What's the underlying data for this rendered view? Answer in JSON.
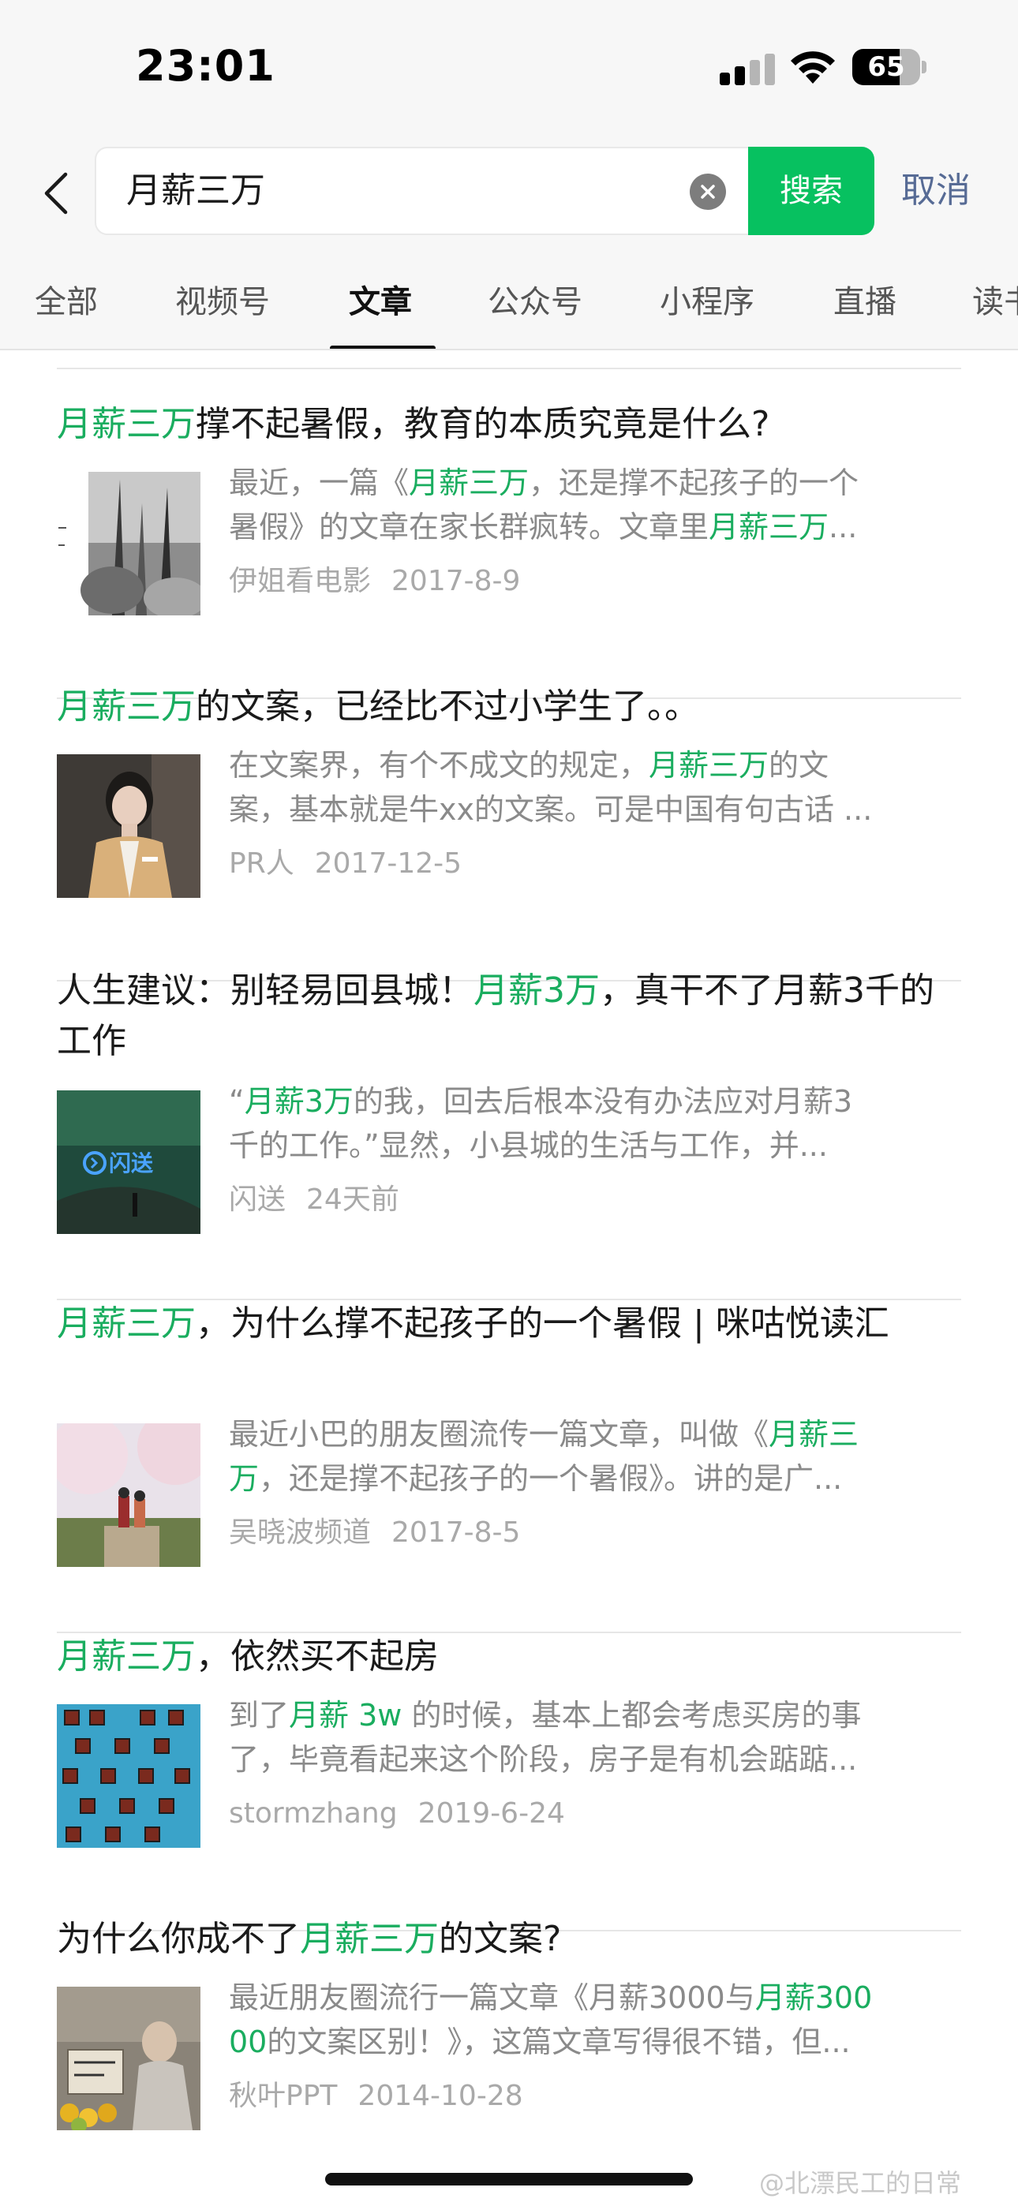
{
  "status_bar": {
    "time": "23:01",
    "battery": "65"
  },
  "search": {
    "query": "月薪三万",
    "search_button": "搜索",
    "cancel_button": "取消"
  },
  "tabs": [
    "全部",
    "视频号",
    "文章",
    "公众号",
    "小程序",
    "直播",
    "读书"
  ],
  "active_tab": "文章",
  "colors": {
    "accent_green": "#07c160",
    "highlight_green": "#1aad5f",
    "cancel_blue": "#576b95"
  },
  "results": [
    {
      "title": [
        {
          "t": "月薪三万",
          "hl": true
        },
        {
          "t": "撑不起暑假，教育的本质究竟是什么?",
          "hl": false
        }
      ],
      "snippet": [
        [
          {
            "t": "最近，一篇《",
            "hl": false
          },
          {
            "t": "月薪三万",
            "hl": true
          },
          {
            "t": "，还是撑不起孩子的一个",
            "hl": false
          }
        ],
        [
          {
            "t": "暑假》的文章在家长群疯转。文章里",
            "hl": false
          },
          {
            "t": "月薪三万",
            "hl": true
          },
          {
            "t": "...",
            "hl": false
          }
        ]
      ],
      "source": "伊姐看电影",
      "date": "2017-8-9",
      "thumb_icon": "photo-forest-icon"
    },
    {
      "title": [
        {
          "t": "月薪三万",
          "hl": true
        },
        {
          "t": "的文案，已经比不过小学生了。。",
          "hl": false
        }
      ],
      "snippet": [
        [
          {
            "t": "在文案界，有个不成文的规定，",
            "hl": false
          },
          {
            "t": "月薪三万",
            "hl": true
          },
          {
            "t": "的文",
            "hl": false
          }
        ],
        [
          {
            "t": "案，基本就是牛xx的文案。可是中国有句古话 ...",
            "hl": false
          }
        ]
      ],
      "source": "PR人",
      "date": "2017-12-5",
      "thumb_icon": "photo-woman-icon"
    },
    {
      "title": [
        {
          "t": "人生建议：别轻易回县城！",
          "hl": false
        },
        {
          "t": "月薪3万",
          "hl": true
        },
        {
          "t": "，真干不了月薪3千的工作",
          "hl": false
        }
      ],
      "snippet": [
        [
          {
            "t": "“",
            "hl": false
          },
          {
            "t": "月薪3万",
            "hl": true
          },
          {
            "t": "的我，回去后根本没有办法应对月薪3",
            "hl": false
          }
        ],
        [
          {
            "t": "千的工作。”显然，小县城的生活与工作，并...",
            "hl": false
          }
        ]
      ],
      "source": "闪送",
      "date": "24天前",
      "thumb_icon": "photo-shansong-logo-icon",
      "thumb_logo_text": "闪送"
    },
    {
      "title": [
        {
          "t": "月薪三万",
          "hl": true
        },
        {
          "t": "，为什么撑不起孩子的一个暑假 | 咪咕悦读汇",
          "hl": false
        }
      ],
      "snippet": [
        [
          {
            "t": "最近小巴的朋友圈流传一篇文章，叫做《",
            "hl": false
          },
          {
            "t": "月薪三",
            "hl": true
          }
        ],
        [
          {
            "t": "万",
            "hl": true
          },
          {
            "t": "，还是撑不起孩子的一个暑假》。讲的是广...",
            "hl": false
          }
        ]
      ],
      "source": "吴晓波频道",
      "date": "2017-8-5",
      "thumb_icon": "photo-cherry-blossom-icon"
    },
    {
      "title": [
        {
          "t": "月薪三万",
          "hl": true
        },
        {
          "t": "，依然买不起房",
          "hl": false
        }
      ],
      "snippet": [
        [
          {
            "t": "到了",
            "hl": false
          },
          {
            "t": "月薪 3w",
            "hl": true
          },
          {
            "t": " 的时候，基本上都会考虑买房的事",
            "hl": false
          }
        ],
        [
          {
            "t": "了，毕竟看起来这个阶段，房子是有机会踮踮...",
            "hl": false
          }
        ]
      ],
      "source": "stormzhang",
      "date": "2019-6-24",
      "thumb_icon": "photo-building-windows-icon"
    },
    {
      "title": [
        {
          "t": "为什么你成不了",
          "hl": false
        },
        {
          "t": "月薪三万",
          "hl": true
        },
        {
          "t": "的文案?",
          "hl": false
        }
      ],
      "snippet": [
        [
          {
            "t": "最近朋友圈流行一篇文章《月薪3000与",
            "hl": false
          },
          {
            "t": "月薪300",
            "hl": true
          }
        ],
        [
          {
            "t": "00",
            "hl": true
          },
          {
            "t": "的文案区别！》，这篇文章写得很不错，但...",
            "hl": false
          }
        ]
      ],
      "source": "秋叶PPT",
      "date": "2014-10-28",
      "thumb_icon": "photo-street-vendor-icon"
    }
  ],
  "watermark": "@北漂民工的日常"
}
